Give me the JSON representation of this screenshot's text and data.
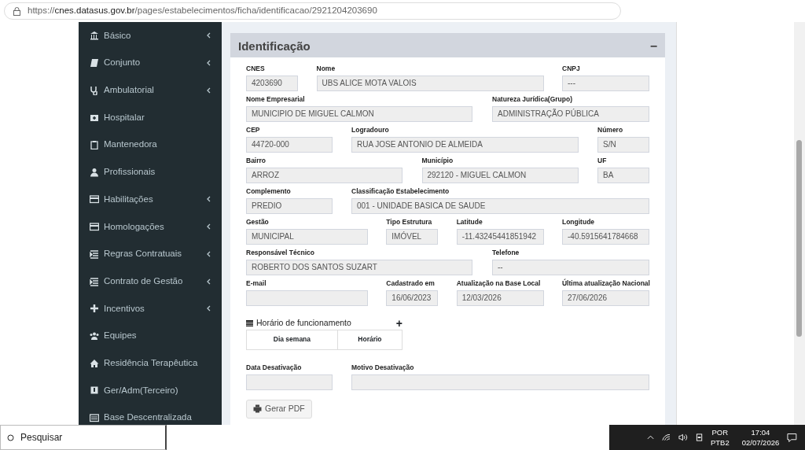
{
  "browser": {
    "url": "https://**cnes.datasus.gov.br**/pages/estabelecimentos/ficha/identificacao/2921204203690"
  },
  "sidebar": {
    "items": [
      {
        "label": "Básico",
        "expandable": true
      },
      {
        "label": "Conjunto",
        "expandable": true
      },
      {
        "label": "Ambulatorial",
        "expandable": true
      },
      {
        "label": "Hospitalar",
        "expandable": false
      },
      {
        "label": "Mantenedora",
        "expandable": false
      },
      {
        "label": "Profissionais",
        "expandable": false
      },
      {
        "label": "Habilitações",
        "expandable": true
      },
      {
        "label": "Homologações",
        "expandable": true
      },
      {
        "label": "Regras Contratuais",
        "expandable": true
      },
      {
        "label": "Contrato de Gestão",
        "expandable": true
      },
      {
        "label": "Incentivos",
        "expandable": true
      },
      {
        "label": "Equipes",
        "expandable": false
      },
      {
        "label": "Residência Terapêutica",
        "expandable": false
      },
      {
        "label": "Ger/Adm(Terceiro)",
        "expandable": false
      },
      {
        "label": "Base Descentralizada",
        "expandable": false
      }
    ]
  },
  "panel": {
    "title": "Identificação",
    "collapse": "−",
    "fields": [
      {
        "label": "CNES",
        "value": "4203690"
      },
      {
        "label": "Nome",
        "value": "UBS ALICE MOTA VALOIS"
      },
      {
        "label": "CNPJ",
        "value": "---"
      },
      {
        "label": "Nome Empresarial",
        "value": "MUNICIPIO DE MIGUEL CALMON"
      },
      {
        "label": "Natureza Jurídica(Grupo)",
        "value": "ADMINISTRAÇÃO PÚBLICA"
      },
      {
        "label": "CEP",
        "value": "44720-000"
      },
      {
        "label": "Logradouro",
        "value": "RUA JOSE ANTONIO DE ALMEIDA"
      },
      {
        "label": "Número",
        "value": "S/N"
      },
      {
        "label": "Bairro",
        "value": "ARROZ"
      },
      {
        "label": "Município",
        "value": "292120 - MIGUEL CALMON"
      },
      {
        "label": "UF",
        "value": "BA"
      },
      {
        "label": "Complemento",
        "value": "PREDIO"
      },
      {
        "label": "Classificação Estabelecimento",
        "value": "001 - UNIDADE BASICA DE SAUDE"
      },
      {
        "label": "Gestão",
        "value": "MUNICIPAL"
      },
      {
        "label": "Tipo Estrutura",
        "value": "IMÓVEL"
      },
      {
        "label": "Latitude",
        "value": "-11.43245441851942"
      },
      {
        "label": "Longitude",
        "value": "-40.5915641784668"
      },
      {
        "label": "Responsável Técnico",
        "value": "ROBERTO DOS SANTOS SUZART"
      },
      {
        "label": "Telefone",
        "value": "--"
      },
      {
        "label": "E-mail"
      },
      {
        "label": "Cadastrado em",
        "value": "16/06/2023"
      },
      {
        "label": "Atualização na Base Local",
        "value": "12/03/2026"
      },
      {
        "label": "Última atualização Nacional",
        "value": "27/06/2026"
      }
    ],
    "schedule": {
      "title": "Horário de funcionamento",
      "add": "+",
      "columns": [
        "Dia semana",
        "Horário"
      ]
    },
    "deactivation": [
      {
        "label": "Data Desativação"
      },
      {
        "label": "Motivo Desativação"
      }
    ],
    "button": "Gerar PDF"
  },
  "taskbar": {
    "search_placeholder": "Pesquisar",
    "language": "POR",
    "layout": "PTB2",
    "time": "17:04",
    "date": "02/07/2026"
  }
}
